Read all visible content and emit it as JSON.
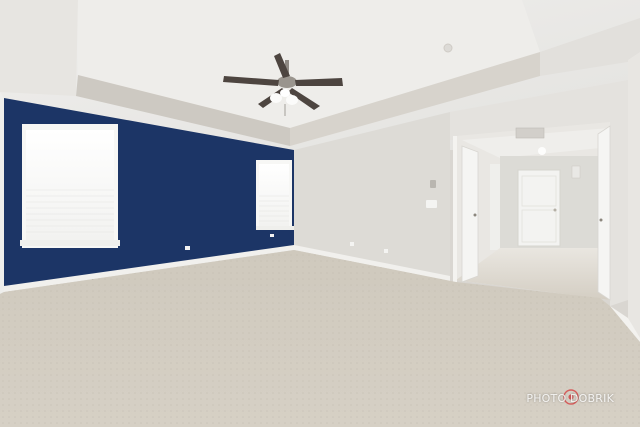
{
  "watermark": {
    "text": "PHOTO DOBRIK",
    "mark": "camera-logo-mark"
  },
  "scene": {
    "subject": "empty-bedroom",
    "colors": {
      "accent_wall": "#1c3566",
      "walls": "#dedcd7",
      "ceiling": "#ecebe8",
      "carpet": "#d2ccc0",
      "trim": "#f3f2ef"
    }
  }
}
